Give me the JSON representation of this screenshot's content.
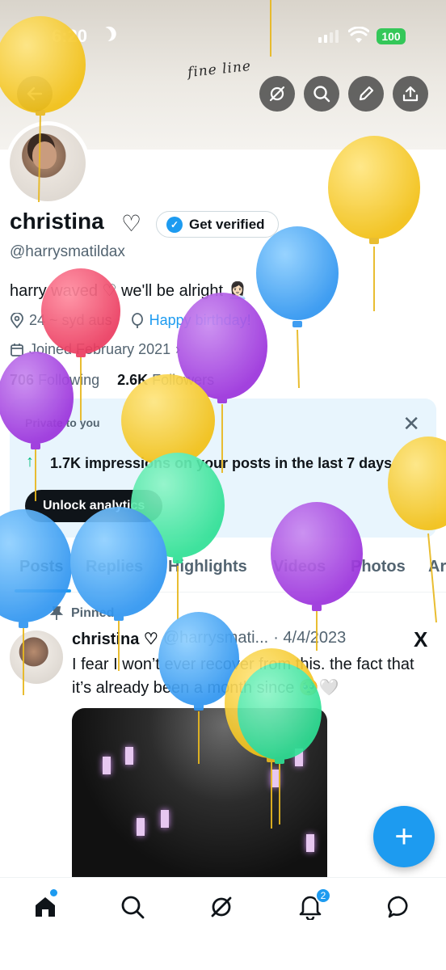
{
  "status_bar": {
    "time": "6:20",
    "battery": "100"
  },
  "banner": {
    "script_text": "fine line"
  },
  "profile": {
    "name": "christina",
    "name_suffix": "♡",
    "verify_label": "Get verified",
    "handle": "@harrysmatildax",
    "bio": "harry waved ♡ we'll be alright 👩🏻‍💼",
    "location": "24 ~ syd aus",
    "website": "Happy birthday!",
    "joined": "Joined February 2021",
    "following_count": "706",
    "following_label": "Following",
    "followers_count": "2.6K",
    "followers_label": "Followers"
  },
  "analytics_card": {
    "label": "Private to you",
    "text": "1.7K impressions on your posts in the last 7 days",
    "button": "Unlock analytics"
  },
  "tabs": [
    "Posts",
    "Replies",
    "Highlights",
    "Videos",
    "Photos",
    "Ar"
  ],
  "post": {
    "pinned_label": "Pinned",
    "author": "christina ♡",
    "handle": "@harrysmati...",
    "date": "· 4/4/2023",
    "text": "I fear I won’t ever recover from this. the fact that it’s already been a month since 🥺🤍"
  },
  "bottom_nav": {
    "notification_count": "2"
  },
  "colors": {
    "accent": "#1d9bf0",
    "balloon_yellow": "#f5c518",
    "balloon_blue": "#3aa0f5",
    "balloon_purple": "#a23fe0",
    "balloon_pink": "#ef4a6a",
    "balloon_green": "#3ee6a0"
  },
  "icons": [
    "back-arrow-icon",
    "grok-icon",
    "search-icon",
    "edit-icon",
    "share-icon",
    "location-icon",
    "balloon-icon",
    "calendar-icon",
    "close-icon",
    "trending-up-icon",
    "pin-icon",
    "x-logo-icon",
    "plus-icon",
    "home-icon",
    "notifications-icon",
    "messages-icon"
  ]
}
